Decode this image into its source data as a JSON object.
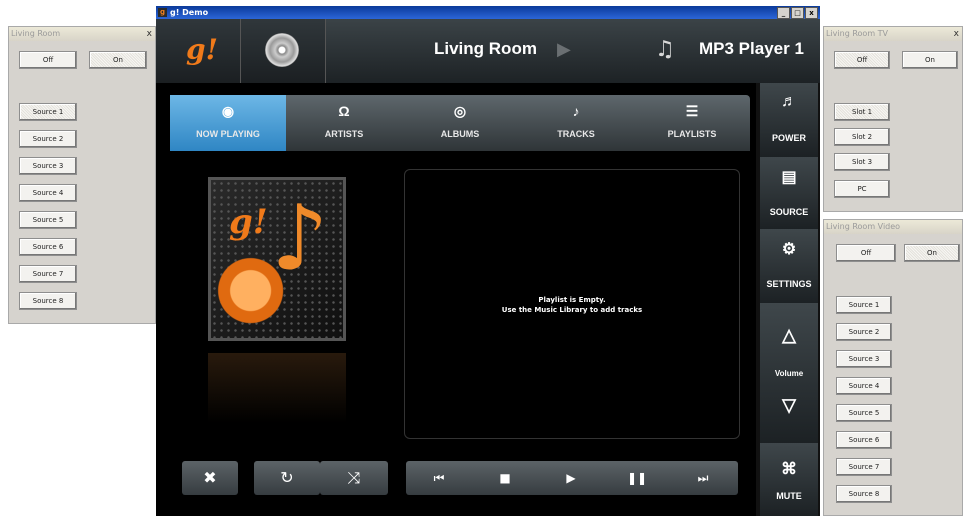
{
  "left_panel": {
    "title": "Living Room",
    "close": "x",
    "off": "Off",
    "on": "On",
    "sources": [
      "Source 1",
      "Source 2",
      "Source 3",
      "Source 4",
      "Source 5",
      "Source 6",
      "Source 7",
      "Source 8"
    ]
  },
  "main_window": {
    "app_icon": "g",
    "title": "g! Demo",
    "minimize": "_",
    "maximize": "□",
    "close": "x"
  },
  "topbar": {
    "logo": "g!",
    "zone": "Living Room",
    "zone_arrow": "▶",
    "note_icon": "♫",
    "player": "MP3 Player 1"
  },
  "tabs": [
    {
      "icon": "◉",
      "label": "NOW PLAYING",
      "active": true
    },
    {
      "icon": "Ω",
      "label": "ARTISTS"
    },
    {
      "icon": "◎",
      "label": "ALBUMS"
    },
    {
      "icon": "♪",
      "label": "TRACKS"
    },
    {
      "icon": "☰",
      "label": "PLAYLISTS"
    }
  ],
  "album_art": {
    "logo": "g!",
    "note": "♪"
  },
  "playlist": {
    "line1": "Playlist is Empty.",
    "line2": "Use the Music Library to add tracks"
  },
  "controls": {
    "clear": "✖",
    "repeat": "↻",
    "shuffle": "⤨",
    "prev": "⏮",
    "stop": "■",
    "play": "▶",
    "pause": "❚❚",
    "next": "⏭"
  },
  "sidebar": {
    "power": {
      "icon": "♬",
      "label": "POWER"
    },
    "source": {
      "icon": "▤",
      "label": "SOURCE"
    },
    "settings": {
      "icon": "⚙",
      "label": "SETTINGS"
    },
    "volume_up": "△",
    "volume": "Volume",
    "volume_down": "▽",
    "mute": {
      "icon": "⌘",
      "label": "MUTE"
    }
  },
  "tv_panel": {
    "title": "Living Room TV",
    "close": "x",
    "off": "Off",
    "on": "On",
    "slots": [
      "Slot 1",
      "Slot 2",
      "Slot 3",
      "PC"
    ]
  },
  "video_panel": {
    "title": "Living Room Video",
    "off": "Off",
    "on": "On",
    "sources": [
      "Source 1",
      "Source 2",
      "Source 3",
      "Source 4",
      "Source 5",
      "Source 6",
      "Source 7",
      "Source 8"
    ]
  }
}
